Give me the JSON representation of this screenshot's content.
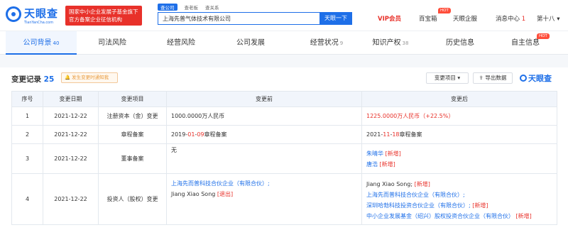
{
  "header": {
    "logo_name": "天眼查",
    "logo_sub": "TianYanCha.com",
    "badge_line1": "国家中小企业发展子基金旗下",
    "badge_line2": "官方备案企业征信机构",
    "search_tabs": [
      "查公司",
      "查老板",
      "查关系"
    ],
    "search_value": "上海先普气体技术有限公司",
    "search_button": "天眼一下",
    "vip": "VIP会员",
    "nav": [
      "百宝箱",
      "天眼企服",
      "消息中心",
      "1",
      "第十八"
    ],
    "hot": "HOT"
  },
  "tabs": [
    {
      "label": "公司背景",
      "count": "40"
    },
    {
      "label": "司法风险",
      "count": ""
    },
    {
      "label": "经营风险",
      "count": ""
    },
    {
      "label": "公司发展",
      "count": ""
    },
    {
      "label": "经营状况",
      "count": "9"
    },
    {
      "label": "知识产权",
      "count": "38"
    },
    {
      "label": "历史信息",
      "count": ""
    },
    {
      "label": "自主信息",
      "count": ""
    }
  ],
  "section": {
    "title": "变更记录",
    "count": "25",
    "notify": "发生变更时通知我",
    "filter": "变更项目",
    "export": "导出数据",
    "watermark": "天眼查"
  },
  "table": {
    "headers": [
      "序号",
      "变更日期",
      "变更项目",
      "变更前",
      "变更后"
    ],
    "rows": [
      {
        "no": "1",
        "date": "2021-12-22",
        "item": "注册资本（金）变更",
        "before": "1000.0000万人民币",
        "after": "1225.0000万人民币（+22.5%）"
      },
      {
        "no": "2",
        "date": "2021-12-22",
        "item": "章程备案",
        "before_a": "2019-",
        "before_b": "01",
        "before_c": "-",
        "before_d": "09",
        "before_e": "章程备案",
        "after_a": "2021-",
        "after_b": "11",
        "after_c": "-",
        "after_d": "18",
        "after_e": "章程备案"
      },
      {
        "no": "3",
        "date": "2021-12-22",
        "item": "董事备案",
        "before": "无",
        "after1": "朱晴华",
        "after2": "唐浩",
        "tag_new": "[新增]"
      },
      {
        "no": "4",
        "date": "2021-12-22",
        "item": "投资人（股权）变更",
        "before1": "上海先而普科技合伙企业（有限合伙）;",
        "before2": "Jiang Xiao Song",
        "tag_exit": "[退出]",
        "after1": "Jiang Xiao Song;",
        "after2": "上海先而普科技合伙企业（有限合伙）;",
        "after3": "深圳哈勃科技投资合伙企业（有限合伙）;",
        "after4": "中小企业发展基金（绍兴）股权投资合伙企业（有限合伙）",
        "tag_new": "[新增]"
      }
    ]
  }
}
